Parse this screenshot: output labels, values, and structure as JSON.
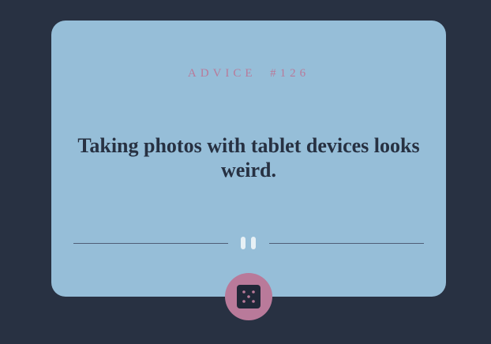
{
  "advice": {
    "label": "ADVICE  #126",
    "text": "Taking photos with tablet devices looks weird."
  },
  "icons": {
    "divider": "pause-icon",
    "button": "dice-icon"
  },
  "colors": {
    "background": "#283142",
    "card": "#96bed8",
    "accent": "#b97a9a",
    "text": "#273142"
  }
}
